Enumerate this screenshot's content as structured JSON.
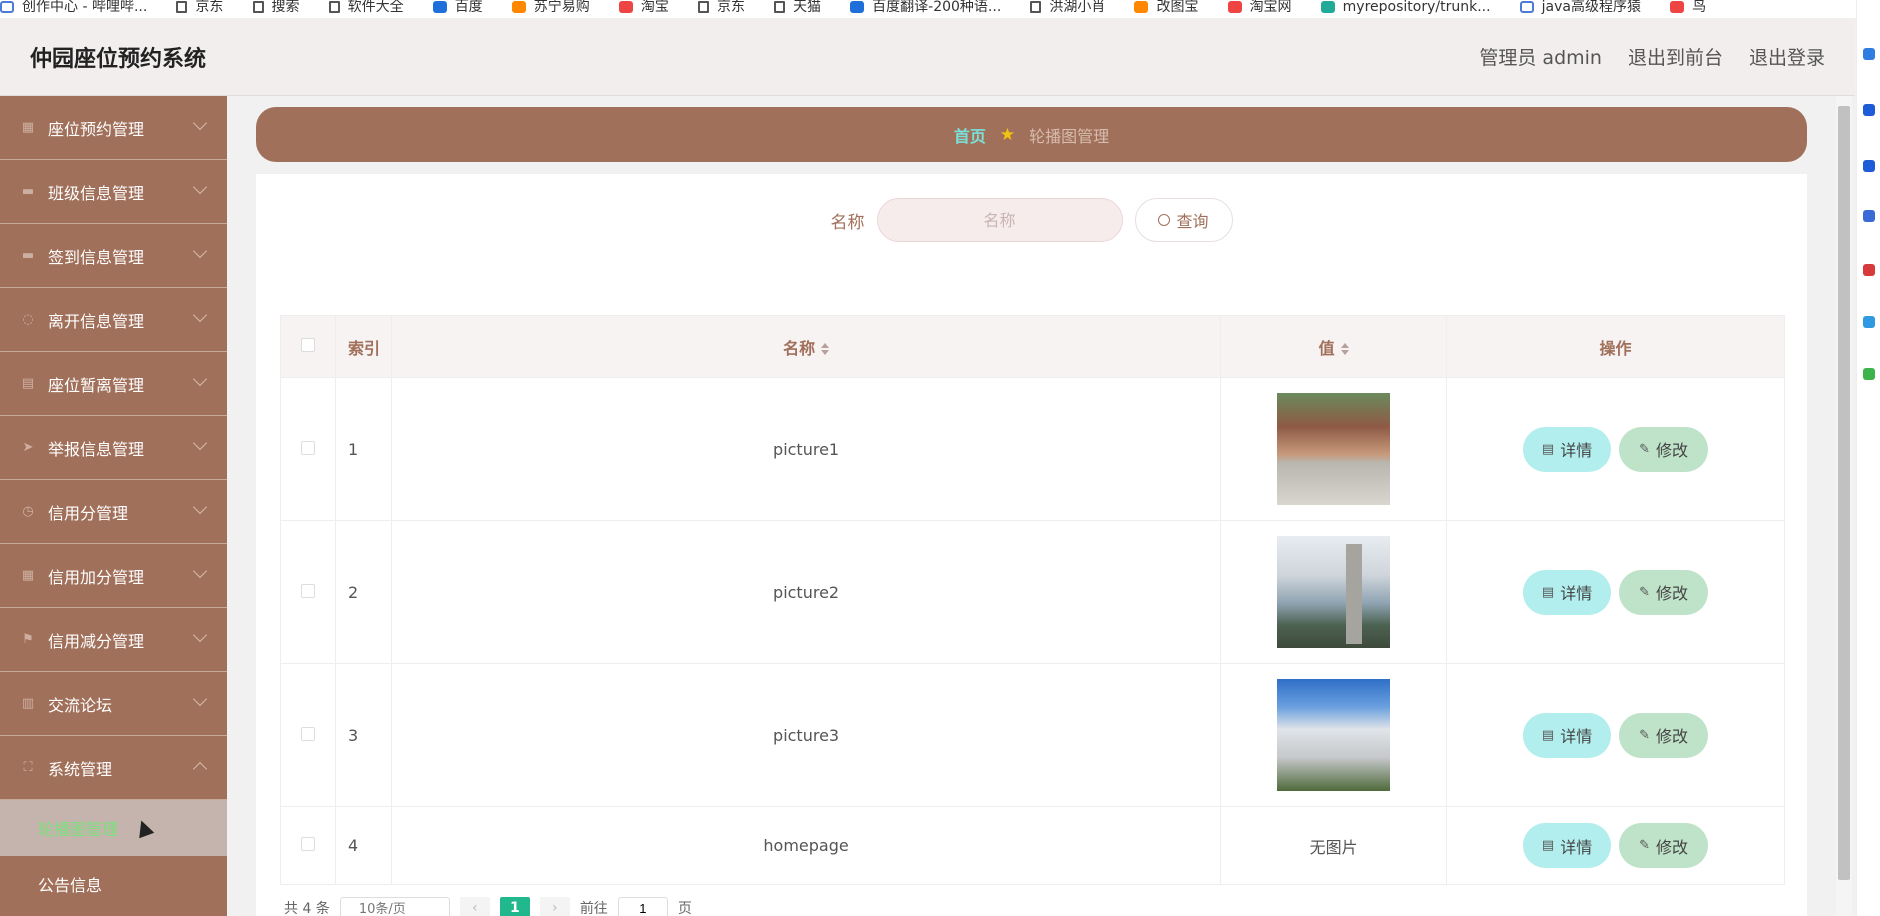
{
  "bookmarks": [
    {
      "label": "创作中心 - 哔哩哔...",
      "icon": "bilibili-icon"
    },
    {
      "label": "京东",
      "icon": "file-icon"
    },
    {
      "label": "搜索",
      "icon": "file-icon"
    },
    {
      "label": "软件大全",
      "icon": "file-icon"
    },
    {
      "label": "百度",
      "icon": "baidu-icon"
    },
    {
      "label": "苏宁易购",
      "icon": "suning-icon"
    },
    {
      "label": "淘宝",
      "icon": "taobao-icon"
    },
    {
      "label": "京东",
      "icon": "file-icon"
    },
    {
      "label": "天猫",
      "icon": "file-icon"
    },
    {
      "label": "百度翻译-200种语...",
      "icon": "baidu-translate-icon"
    },
    {
      "label": "洪湖小肖",
      "icon": "bird-icon"
    },
    {
      "label": "改图宝",
      "icon": "gaitubao-icon"
    },
    {
      "label": "淘宝网",
      "icon": "taobao-icon"
    },
    {
      "label": "myrepository/trunk...",
      "icon": "chrome-icon"
    },
    {
      "label": "java高级程序猿",
      "icon": "bilibili-icon"
    },
    {
      "label": "鸟",
      "icon": "bird-icon"
    }
  ],
  "header": {
    "title": "仲园座位预约系统",
    "admin": "管理员 admin",
    "front": "退出到前台",
    "logout": "退出登录"
  },
  "sidebar": {
    "items": [
      {
        "label": "座位预约管理",
        "icon": "grid-icon"
      },
      {
        "label": "班级信息管理",
        "icon": "monitor-icon"
      },
      {
        "label": "签到信息管理",
        "icon": "monitor-icon"
      },
      {
        "label": "离开信息管理",
        "icon": "compass-icon"
      },
      {
        "label": "座位暂离管理",
        "icon": "printer-icon"
      },
      {
        "label": "举报信息管理",
        "icon": "send-icon"
      },
      {
        "label": "信用分管理",
        "icon": "clock-icon"
      },
      {
        "label": "信用加分管理",
        "icon": "grid-icon"
      },
      {
        "label": "信用减分管理",
        "icon": "flag-icon"
      },
      {
        "label": "交流论坛",
        "icon": "chart-icon"
      },
      {
        "label": "系统管理",
        "icon": "frame-icon"
      }
    ],
    "sub_items": [
      {
        "label": "轮播图管理",
        "active": true
      },
      {
        "label": "公告信息",
        "active": false
      }
    ]
  },
  "breadcrumb": {
    "home": "首页",
    "current": "轮播图管理"
  },
  "search": {
    "label": "名称",
    "placeholder": "名称",
    "button": "查询"
  },
  "table": {
    "headers": {
      "index": "索引",
      "name": "名称",
      "value": "值",
      "ops": "操作"
    },
    "rows": [
      {
        "index": "1",
        "name": "picture1",
        "value_type": "image",
        "value_text": ""
      },
      {
        "index": "2",
        "name": "picture2",
        "value_type": "image",
        "value_text": ""
      },
      {
        "index": "3",
        "name": "picture3",
        "value_type": "image",
        "value_text": ""
      },
      {
        "index": "4",
        "name": "homepage",
        "value_type": "text",
        "value_text": "无图片"
      }
    ],
    "detail_label": "详情",
    "edit_label": "修改"
  },
  "pagination": {
    "total": "共 4 条",
    "page_size": "10条/页",
    "current_page": "1",
    "goto_label": "前往",
    "goto_value": "1",
    "page_unit": "页"
  },
  "colors": {
    "brand": "#a1705a",
    "accent_cyan": "#b3eeee",
    "accent_green": "#bfe3c9",
    "active_page": "#20b88c"
  }
}
